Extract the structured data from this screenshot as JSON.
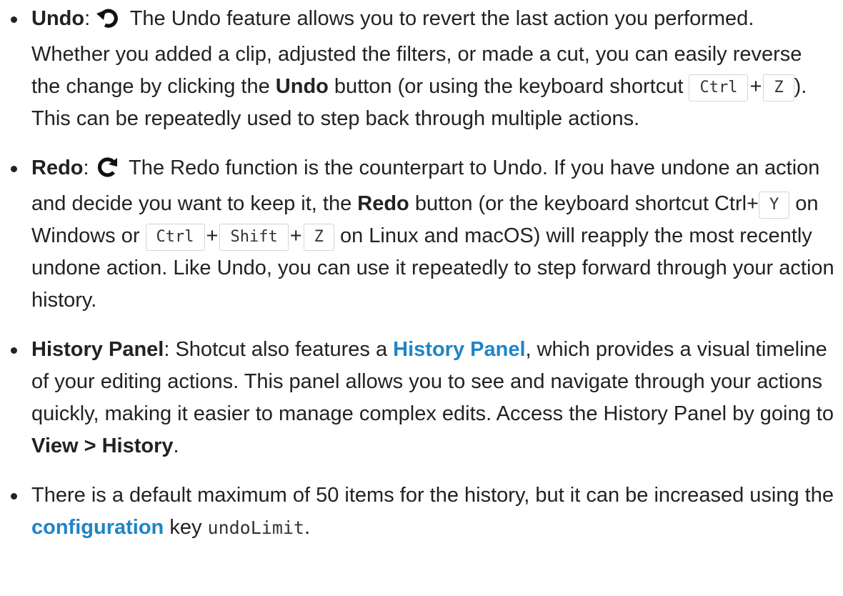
{
  "items": [
    {
      "title": "Undo",
      "sep": ":",
      "icon": "undo-icon",
      "t1": " The Undo feature allows you to revert the last action you performed. Whether you added a clip, adjusted the filters, or made a cut, you can easily reverse the change by clicking the ",
      "bold": "Undo",
      "t2": " button (or using the keyboard shortcut ",
      "key1": "Ctrl",
      "plus": "+",
      "key2": "Z",
      "t3": "). This can be repeatedly used to step back through multiple actions."
    },
    {
      "title": "Redo",
      "sep": ":",
      "icon": "redo-icon",
      "t1": " The Redo function is the counterpart to Undo. If you have undone an action and decide you want to keep it, the ",
      "bold": "Redo",
      "t2": " button (or the keyboard shortcut Ctrl+",
      "key1": "Y",
      "t3": " on Windows or ",
      "key2": "Ctrl",
      "plus": "+",
      "key3": "Shift",
      "key4": "Z",
      "t4": " on Linux and macOS) will reapply the most recently undone action. Like Undo, you can use it repeatedly to step forward through your action history."
    },
    {
      "title": "History Panel",
      "sep": ":",
      "t1": " Shotcut also features a ",
      "link": "History Panel",
      "t2": ", which provides a visual timeline of your editing actions. This panel allows you to see and navigate through your actions quickly, making it easier to manage complex edits. Access the History Panel by going to ",
      "bold": "View > History",
      "t3": "."
    },
    {
      "t1": "There is a default maximum of 50 items for the history, but it can be increased using the ",
      "link": "configuration",
      "t2": " key ",
      "code": "undoLimit",
      "t3": "."
    }
  ],
  "colors": {
    "text": "#222222",
    "link": "#1f84c6",
    "key_border": "#d4d4d4"
  }
}
